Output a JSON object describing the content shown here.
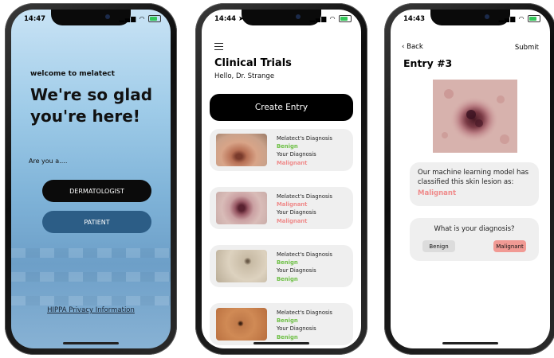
{
  "screen1": {
    "time": "14:47",
    "welcome": "welcome to melatect",
    "headline": "We're so glad you're here!",
    "prompt": "Are you a....",
    "dermatologist_label": "DERMATOLOGIST",
    "patient_label": "PATIENT",
    "privacy_link": "HIPPA Privacy Information"
  },
  "screen2": {
    "time": "14:44",
    "title": "Clinical Trials",
    "greeting": "Hello, Dr. Strange",
    "create_label": "Create Entry",
    "cards": [
      {
        "melatect_label": "Melatect's Diagnosis",
        "melatect_value": "Benign",
        "your_label": "Your Diagnosis",
        "your_value": "Malignant"
      },
      {
        "melatect_label": "Melatect's Diagnosis",
        "melatect_value": "Malignant",
        "your_label": "Your Diagnosis",
        "your_value": "Malignant"
      },
      {
        "melatect_label": "Melatect's Diagnosis",
        "melatect_value": "Benign",
        "your_label": "Your Diagnosis",
        "your_value": "Benign"
      },
      {
        "melatect_label": "Melatect's Diagnosis",
        "melatect_value": "Benign",
        "your_label": "Your Diagnosis",
        "your_value": "Benign"
      }
    ]
  },
  "screen3": {
    "time": "14:43",
    "back_label": "Back",
    "submit_label": "Submit",
    "entry_title": "Entry #3",
    "model_text": "Our machine learning model has classified this skin lesion as:",
    "model_result": "Malignant",
    "question": "What is your diagnosis?",
    "benign_label": "Benign",
    "malignant_label": "Malignant"
  },
  "colors": {
    "benign": "#6cbf43",
    "malignant": "#ef8a8a",
    "patient_button": "#2c5d86",
    "malignant_pill": "#f19a94"
  },
  "icons": [
    "signal-icon",
    "wifi-icon",
    "battery-icon",
    "hamburger-menu-icon",
    "chevron-left-icon",
    "location-arrow-icon"
  ]
}
